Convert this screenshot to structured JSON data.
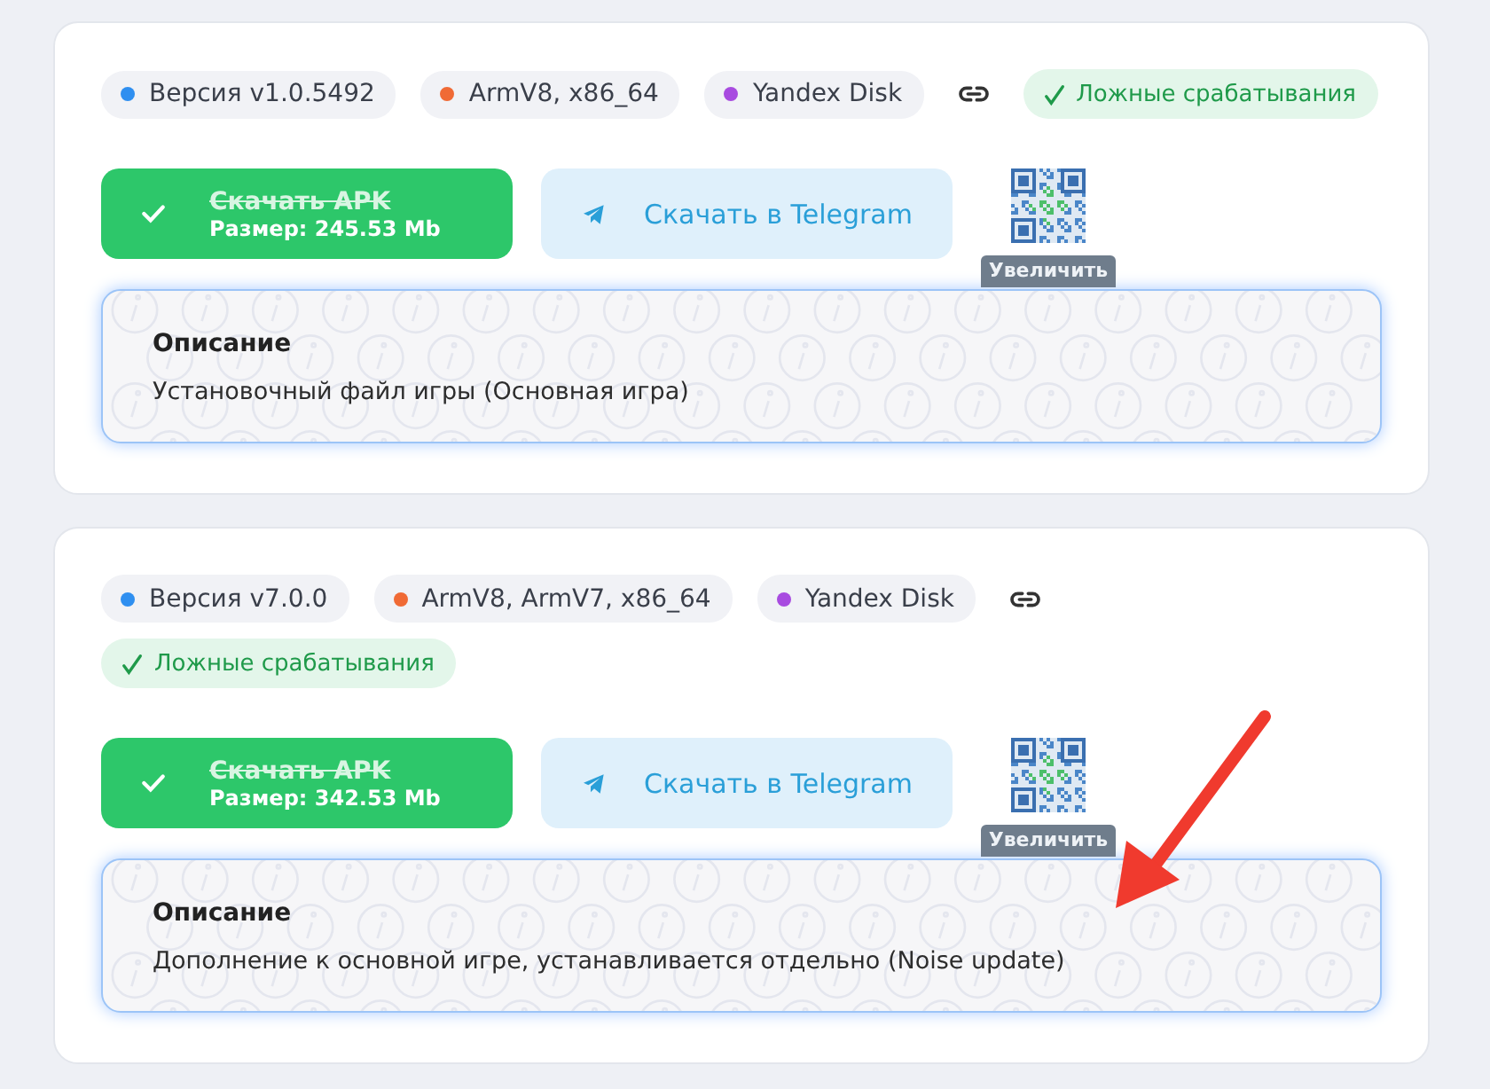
{
  "cards": [
    {
      "chips": [
        {
          "label": "Версия v1.0.5492",
          "color": "#2f8ff0"
        },
        {
          "label": "ArmV8, x86_64",
          "color": "#f06a35"
        },
        {
          "label": "Yandex Disk",
          "color": "#a84be0"
        }
      ],
      "status": {
        "label": "Ложные срабатывания"
      },
      "download": {
        "title": "Скачать APK",
        "strikethrough": true,
        "size": "Размер: 245.53 Mb"
      },
      "telegram": {
        "label": "Скачать в Telegram"
      },
      "qr_tooltip": "Увеличить",
      "description": {
        "title": "Описание",
        "text": "Установочный файл игры (Основная игра)"
      }
    },
    {
      "chips": [
        {
          "label": "Версия v7.0.0",
          "color": "#2f8ff0"
        },
        {
          "label": "ArmV8, ArmV7, x86_64",
          "color": "#f06a35"
        },
        {
          "label": "Yandex Disk",
          "color": "#a84be0"
        }
      ],
      "status": {
        "label": "Ложные срабатывания"
      },
      "download": {
        "title": "Скачать APK",
        "strikethrough": true,
        "size": "Размер: 342.53 Mb"
      },
      "telegram": {
        "label": "Скачать в Telegram"
      },
      "qr_tooltip": "Увеличить",
      "description": {
        "title": "Описание",
        "text": "Дополнение к основной игре, устанавливается отдельно (Noise update)"
      }
    }
  ]
}
